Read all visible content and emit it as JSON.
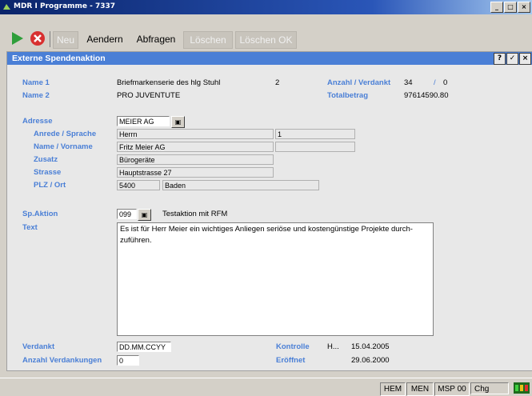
{
  "window": {
    "title": "MDR I Programme - 7337",
    "controls": [
      "_",
      "□",
      "×"
    ]
  },
  "toolbar": {
    "buttons": [
      {
        "label": "Neu",
        "enabled": false
      },
      {
        "label": "Aendern",
        "enabled": true
      },
      {
        "label": "Abfragen",
        "enabled": true
      },
      {
        "label": "Löschen",
        "enabled": false
      },
      {
        "label": "Löschen OK",
        "enabled": false
      }
    ]
  },
  "panel": {
    "title": "Externe Spendenaktion",
    "header_buttons": [
      "?",
      "✓",
      "×"
    ]
  },
  "form": {
    "name1_label": "Name 1",
    "name1_value": "Briefmarkenserie des hlg Stuhl",
    "name1_number": "2",
    "name2_label": "Name 2",
    "name2_value": "PRO JUVENTUTE",
    "anzahl_label": "Anzahl / Verdankt",
    "anzahl_value": "34",
    "anzahl_sep": "/",
    "verdankt_value": "0",
    "total_label": "Totalbetrag",
    "total_value": "97614590.80",
    "adresse_label": "Adresse",
    "adresse_value": "MEIER AG",
    "anrede_label": "Anrede / Sprache",
    "anrede_value": "Herrn",
    "sprache_value": "1",
    "name_vorname_label": "Name / Vorname",
    "name_value": "Fritz Meier AG",
    "vorname_value": "",
    "zusatz_label": "Zusatz",
    "zusatz_value": "Bürogeräte",
    "strasse_label": "Strasse",
    "strasse_value": "Hauptstrasse 27",
    "plz_label": "PLZ / Ort",
    "plz_value": "5400",
    "ort_value": "Baden",
    "sp_aktion_label": "Sp.Aktion",
    "sp_aktion_value": "099",
    "sp_aktion_desc": "Testaktion mit RFM",
    "text_label": "Text",
    "text_line1": "Es ist für Herr Meier ein wichtiges Anliegen seriöse und kostengünstige Projekte durch-",
    "text_line2": "zuführen.",
    "verdankt_label": "Verdankt",
    "verdankt_date": "DD.MM.CCYY",
    "anzahl_verd_label": "Anzahl Verdankungen",
    "anzahl_verd_value": "0",
    "kontrolle_label": "Kontrolle",
    "kontrolle_user": "H...",
    "kontrolle_date": "15.04.2005",
    "eroeffnet_label": "Eröffnet",
    "eroeffnet_date": "29.06.2000"
  },
  "statusbar": {
    "cells": [
      "HEM",
      "MEN",
      "MSP 00",
      "Chg"
    ]
  },
  "colors": {
    "label_blue": "#4a7fd6",
    "header_blue": "#4a7fd6",
    "title_blue": "#0a246a"
  },
  "icons": [
    "app-icon",
    "play-icon",
    "stop-icon",
    "binoculars-icon",
    "status-light-icon"
  ]
}
